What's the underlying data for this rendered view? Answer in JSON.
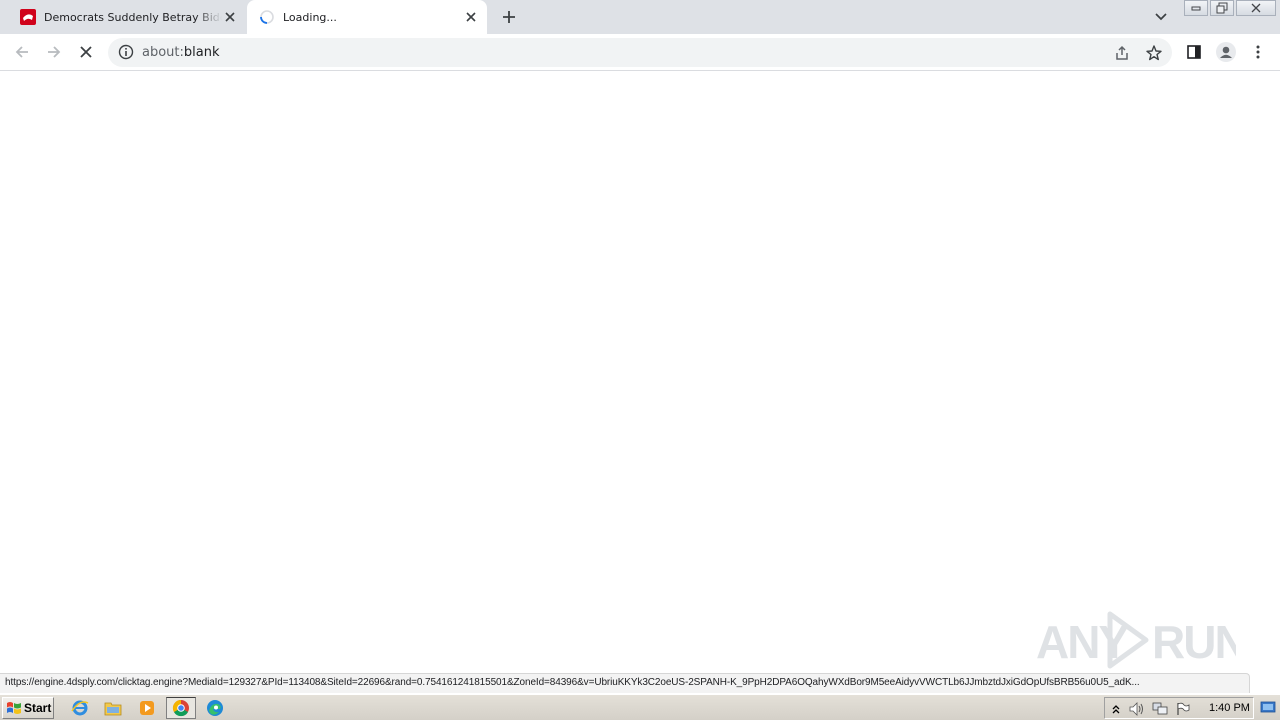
{
  "tabs": [
    {
      "title": "Democrats Suddenly Betray Biden over",
      "favicon": "news-favicon",
      "active": false
    },
    {
      "title": "Loading...",
      "favicon": "loading-spinner",
      "active": true
    }
  ],
  "omnibox": {
    "url_scheme": "about:",
    "url_rest": "blank"
  },
  "status_url": "https://engine.4dsply.com/clicktag.engine?MediaId=129327&PId=113408&SiteId=22696&rand=0.754161241815501&ZoneId=84396&v=UbriuKKYk3C2oeUS-2SPANH-K_9PpH2DPA6OQahyWXdBor9M5eeAidyvVWCTLb6JJmbztdJxiGdOpUfsBRB56u0U5_adK...",
  "watermark": "ANY RUN",
  "taskbar": {
    "start_label": "Start",
    "clock": "1:40 PM",
    "pinned": [
      "ie-icon",
      "explorer-icon",
      "media-player-icon",
      "chrome-icon",
      "edge-icon"
    ]
  },
  "colors": {
    "tabstrip": "#dee1e6",
    "omnibox": "#f1f3f4",
    "taskbar": "#d4d0c8"
  }
}
